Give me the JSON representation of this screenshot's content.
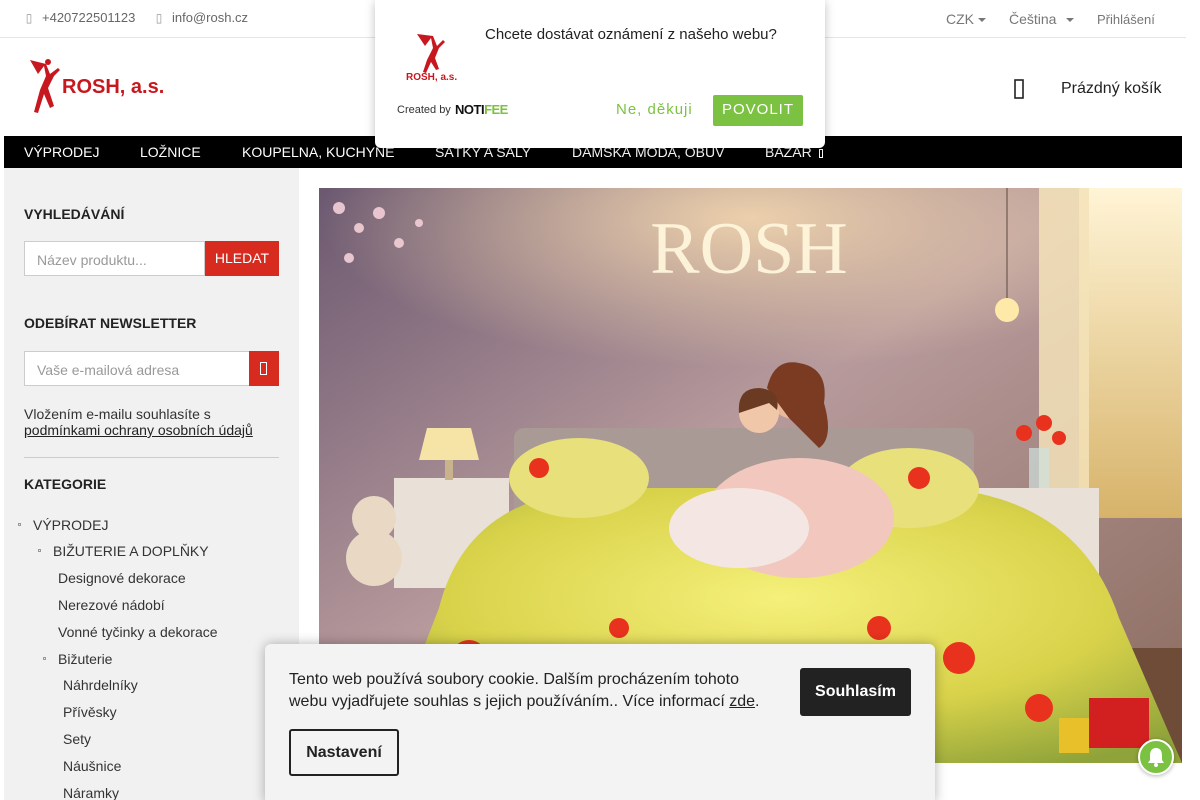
{
  "topbar": {
    "phone": "+420722501123",
    "email": "info@rosh.cz",
    "currency": "CZK",
    "language": "Čeština",
    "login": "Přihlášení"
  },
  "header": {
    "logo_text": "ROSH, a.s.",
    "cart_label": "Prázdný košík"
  },
  "nav": {
    "items": [
      "VÝPRODEJ",
      "LOŽNICE",
      "KOUPELNA, KUCHYNĚ",
      "ŠÁTKY A ŠÁLY",
      "DÁMSKÁ MÓDA, OBUV",
      "BAZAR"
    ]
  },
  "sidebar": {
    "search_heading": "VYHLEDÁVÁNÍ",
    "search_placeholder": "Název produktu...",
    "search_button": "HLEDAT",
    "newsletter_heading": "ODEBÍRAT NEWSLETTER",
    "newsletter_placeholder": "Vaše e-mailová adresa",
    "consent_text": "Vložením e-mailu souhlasíte s",
    "consent_link": "podmínkami ochrany osobních údajů",
    "category_heading": "KATEGORIE",
    "categories": [
      "VÝPRODEJ",
      "BIŽUTERIE A DOPLŇKY",
      "Designové dekorace",
      "Nerezové nádobí",
      "Vonné tyčinky a dekorace",
      "Bižuterie",
      "Náhrdelníky",
      "Přívěsky",
      "Sety",
      "Náušnice",
      "Náramky"
    ]
  },
  "banner": {
    "title": "ROSH"
  },
  "notification": {
    "question": "Chcete dostávat oznámení z našeho webu?",
    "created_by": "Created by",
    "brand_a": "NOTI",
    "brand_b": "FEE",
    "deny": "Ne, děkuji",
    "allow": "POVOLIT",
    "logo_text": "ROSH, a.s."
  },
  "cookie": {
    "text": "Tento web používá soubory cookie. Dalším procházením tohoto webu vyjadřujete souhlas s jejich používáním.. Více informací",
    "link": "zde",
    "accept": "Souhlasím",
    "settings": "Nastavení"
  },
  "colors": {
    "accent_red": "#d62b1e",
    "nav_bg": "#000000",
    "notif_green": "#7cc242"
  }
}
